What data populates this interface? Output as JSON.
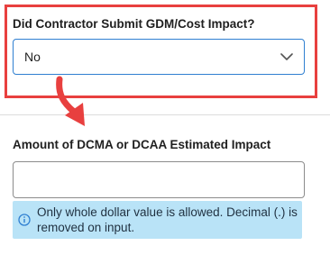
{
  "gdm_field": {
    "label": "Did Contractor Submit GDM/Cost Impact?",
    "selected_value": "No"
  },
  "impact_field": {
    "label": "Amount of DCMA or DCAA Estimated Impact",
    "value": "",
    "info_message": "Only whole dollar value is allowed. Decimal (.) is removed on input."
  },
  "icons": {
    "dropdown": "chevron-down-icon",
    "info": "info-icon",
    "annotation": "red-arrow"
  },
  "colors": {
    "highlight": "#e8403f",
    "select_border": "#2f7fd1",
    "info_background": "#b9e3f7",
    "info_icon": "#2f7fd1"
  }
}
